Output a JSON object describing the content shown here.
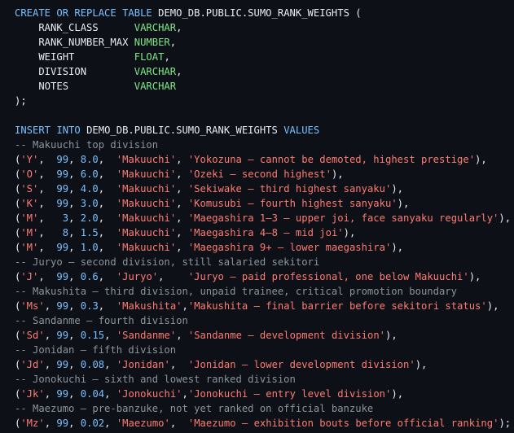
{
  "code_lines": [
    [
      [
        "kw",
        "CREATE OR REPLACE TABLE "
      ],
      [
        "id",
        "DEMO_DB.PUBLIC.SUMO_RANK_WEIGHTS ("
      ]
    ],
    [
      [
        "id",
        "    RANK_CLASS      "
      ],
      [
        "ty",
        "VARCHAR"
      ],
      [
        "pn",
        ","
      ]
    ],
    [
      [
        "id",
        "    RANK_NUMBER_MAX "
      ],
      [
        "ty",
        "NUMBER"
      ],
      [
        "pn",
        ","
      ]
    ],
    [
      [
        "id",
        "    WEIGHT          "
      ],
      [
        "ty",
        "FLOAT"
      ],
      [
        "pn",
        ","
      ]
    ],
    [
      [
        "id",
        "    DIVISION        "
      ],
      [
        "ty",
        "VARCHAR"
      ],
      [
        "pn",
        ","
      ]
    ],
    [
      [
        "id",
        "    NOTES           "
      ],
      [
        "ty",
        "VARCHAR"
      ]
    ],
    [
      [
        "pn",
        ");"
      ]
    ],
    [],
    [
      [
        "kw",
        "INSERT INTO "
      ],
      [
        "id",
        "DEMO_DB.PUBLIC.SUMO_RANK_WEIGHTS "
      ],
      [
        "kw",
        "VALUES"
      ]
    ],
    [
      [
        "cm",
        "-- Makuuchi top division"
      ]
    ],
    [
      [
        "pn",
        "("
      ],
      [
        "str",
        "'Y'"
      ],
      [
        "pn",
        ",  "
      ],
      [
        "num",
        "99"
      ],
      [
        "pn",
        ", "
      ],
      [
        "num",
        "8.0"
      ],
      [
        "pn",
        ",  "
      ],
      [
        "str",
        "'Makuuchi'"
      ],
      [
        "pn",
        ", "
      ],
      [
        "str",
        "'Yokozuna — cannot be demoted, highest prestige'"
      ],
      [
        "pn",
        "),"
      ]
    ],
    [
      [
        "pn",
        "("
      ],
      [
        "str",
        "'O'"
      ],
      [
        "pn",
        ",  "
      ],
      [
        "num",
        "99"
      ],
      [
        "pn",
        ", "
      ],
      [
        "num",
        "6.0"
      ],
      [
        "pn",
        ",  "
      ],
      [
        "str",
        "'Makuuchi'"
      ],
      [
        "pn",
        ", "
      ],
      [
        "str",
        "'Ozeki — second highest'"
      ],
      [
        "pn",
        "),"
      ]
    ],
    [
      [
        "pn",
        "("
      ],
      [
        "str",
        "'S'"
      ],
      [
        "pn",
        ",  "
      ],
      [
        "num",
        "99"
      ],
      [
        "pn",
        ", "
      ],
      [
        "num",
        "4.0"
      ],
      [
        "pn",
        ",  "
      ],
      [
        "str",
        "'Makuuchi'"
      ],
      [
        "pn",
        ", "
      ],
      [
        "str",
        "'Sekiwake — third highest sanyaku'"
      ],
      [
        "pn",
        "),"
      ]
    ],
    [
      [
        "pn",
        "("
      ],
      [
        "str",
        "'K'"
      ],
      [
        "pn",
        ",  "
      ],
      [
        "num",
        "99"
      ],
      [
        "pn",
        ", "
      ],
      [
        "num",
        "3.0"
      ],
      [
        "pn",
        ",  "
      ],
      [
        "str",
        "'Makuuchi'"
      ],
      [
        "pn",
        ", "
      ],
      [
        "str",
        "'Komusubi — fourth highest sanyaku'"
      ],
      [
        "pn",
        "),"
      ]
    ],
    [
      [
        "pn",
        "("
      ],
      [
        "str",
        "'M'"
      ],
      [
        "pn",
        ",   "
      ],
      [
        "num",
        "3"
      ],
      [
        "pn",
        ", "
      ],
      [
        "num",
        "2.0"
      ],
      [
        "pn",
        ",  "
      ],
      [
        "str",
        "'Makuuchi'"
      ],
      [
        "pn",
        ", "
      ],
      [
        "str",
        "'Maegashira 1–3 — upper joi, face sanyaku regularly'"
      ],
      [
        "pn",
        "),"
      ]
    ],
    [
      [
        "pn",
        "("
      ],
      [
        "str",
        "'M'"
      ],
      [
        "pn",
        ",   "
      ],
      [
        "num",
        "8"
      ],
      [
        "pn",
        ", "
      ],
      [
        "num",
        "1.5"
      ],
      [
        "pn",
        ",  "
      ],
      [
        "str",
        "'Makuuchi'"
      ],
      [
        "pn",
        ", "
      ],
      [
        "str",
        "'Maegashira 4–8 — mid joi'"
      ],
      [
        "pn",
        "),"
      ]
    ],
    [
      [
        "pn",
        "("
      ],
      [
        "str",
        "'M'"
      ],
      [
        "pn",
        ",  "
      ],
      [
        "num",
        "99"
      ],
      [
        "pn",
        ", "
      ],
      [
        "num",
        "1.0"
      ],
      [
        "pn",
        ",  "
      ],
      [
        "str",
        "'Makuuchi'"
      ],
      [
        "pn",
        ", "
      ],
      [
        "str",
        "'Maegashira 9+ — lower maegashira'"
      ],
      [
        "pn",
        "),"
      ]
    ],
    [
      [
        "cm",
        "-- Juryo — second division, still salaried sekitori"
      ]
    ],
    [
      [
        "pn",
        "("
      ],
      [
        "str",
        "'J'"
      ],
      [
        "pn",
        ",  "
      ],
      [
        "num",
        "99"
      ],
      [
        "pn",
        ", "
      ],
      [
        "num",
        "0.6"
      ],
      [
        "pn",
        ",  "
      ],
      [
        "str",
        "'Juryo'"
      ],
      [
        "pn",
        ",    "
      ],
      [
        "str",
        "'Juryo — paid professional, one below Makuuchi'"
      ],
      [
        "pn",
        "),"
      ]
    ],
    [
      [
        "cm",
        "-- Makushita — third division, unpaid trainee, critical promotion boundary"
      ]
    ],
    [
      [
        "pn",
        "("
      ],
      [
        "str",
        "'Ms'"
      ],
      [
        "pn",
        ", "
      ],
      [
        "num",
        "99"
      ],
      [
        "pn",
        ", "
      ],
      [
        "num",
        "0.3"
      ],
      [
        "pn",
        ",  "
      ],
      [
        "str",
        "'Makushita'"
      ],
      [
        "pn",
        ","
      ],
      [
        "str",
        "'Makushita — final barrier before sekitori status'"
      ],
      [
        "pn",
        "),"
      ]
    ],
    [
      [
        "cm",
        "-- Sandanme — fourth division"
      ]
    ],
    [
      [
        "pn",
        "("
      ],
      [
        "str",
        "'Sd'"
      ],
      [
        "pn",
        ", "
      ],
      [
        "num",
        "99"
      ],
      [
        "pn",
        ", "
      ],
      [
        "num",
        "0.15"
      ],
      [
        "pn",
        ", "
      ],
      [
        "str",
        "'Sandanme'"
      ],
      [
        "pn",
        ", "
      ],
      [
        "str",
        "'Sandanme — development division'"
      ],
      [
        "pn",
        "),"
      ]
    ],
    [
      [
        "cm",
        "-- Jonidan — fifth division"
      ]
    ],
    [
      [
        "pn",
        "("
      ],
      [
        "str",
        "'Jd'"
      ],
      [
        "pn",
        ", "
      ],
      [
        "num",
        "99"
      ],
      [
        "pn",
        ", "
      ],
      [
        "num",
        "0.08"
      ],
      [
        "pn",
        ", "
      ],
      [
        "str",
        "'Jonidan'"
      ],
      [
        "pn",
        ",  "
      ],
      [
        "str",
        "'Jonidan — lower development division'"
      ],
      [
        "pn",
        "),"
      ]
    ],
    [
      [
        "cm",
        "-- Jonokuchi — sixth and lowest ranked division"
      ]
    ],
    [
      [
        "pn",
        "("
      ],
      [
        "str",
        "'Jk'"
      ],
      [
        "pn",
        ", "
      ],
      [
        "num",
        "99"
      ],
      [
        "pn",
        ", "
      ],
      [
        "num",
        "0.04"
      ],
      [
        "pn",
        ", "
      ],
      [
        "str",
        "'Jonokuchi'"
      ],
      [
        "pn",
        ","
      ],
      [
        "str",
        "'Jonokuchi — entry level division'"
      ],
      [
        "pn",
        "),"
      ]
    ],
    [
      [
        "cm",
        "-- Maezumo — pre-banzuke, not yet ranked on official banzuke"
      ]
    ],
    [
      [
        "pn",
        "("
      ],
      [
        "str",
        "'Mz'"
      ],
      [
        "pn",
        ", "
      ],
      [
        "num",
        "99"
      ],
      [
        "pn",
        ", "
      ],
      [
        "num",
        "0.02"
      ],
      [
        "pn",
        ", "
      ],
      [
        "str",
        "'Maezumo'"
      ],
      [
        "pn",
        ",  "
      ],
      [
        "str",
        "'Maezumo — exhibition bouts before official ranking'"
      ],
      [
        "pn",
        ");"
      ]
    ]
  ],
  "colors": {
    "background": "#0d1117",
    "keyword": "#79c0ff",
    "identifier": "#e6edf3",
    "type": "#7ee787",
    "number": "#79c0ff",
    "string": "#ff7b72",
    "comment": "#8b949e"
  }
}
